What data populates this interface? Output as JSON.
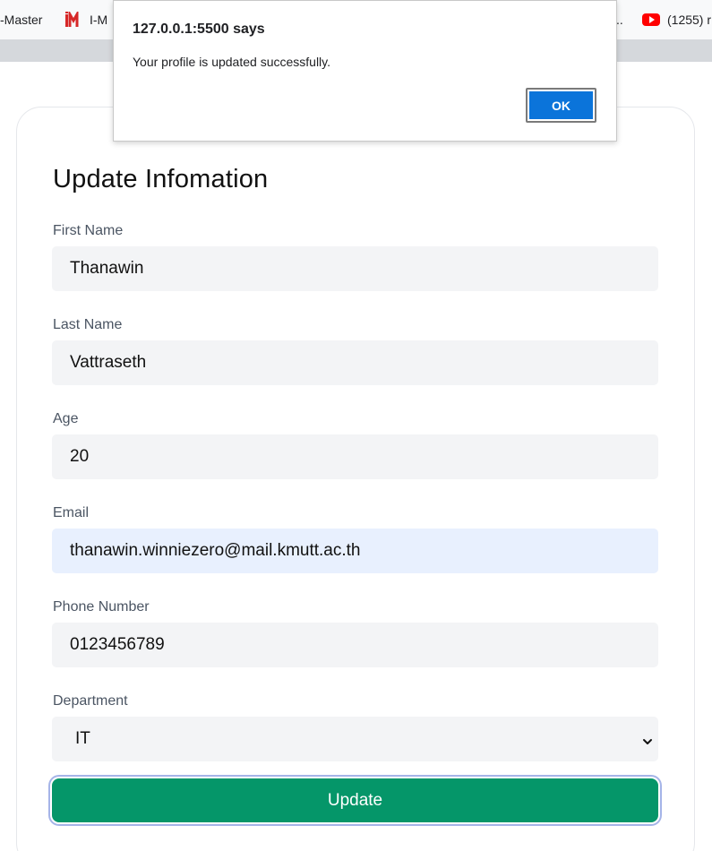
{
  "bookmarks": [
    {
      "label": "-Master",
      "icon": "none"
    },
    {
      "label": "I-M",
      "icon": "imaster-logo-icon"
    },
    {
      "label": "..",
      "icon": "none"
    },
    {
      "label": "(1255) r",
      "icon": "youtube-icon"
    }
  ],
  "alert": {
    "title": "127.0.0.1:5500 says",
    "message": "Your profile is updated successfully.",
    "ok_label": "OK"
  },
  "form": {
    "title": "Update Infomation",
    "fields": [
      {
        "label": "First Name",
        "value": "Thanawin"
      },
      {
        "label": "Last Name",
        "value": "Vattraseth"
      },
      {
        "label": "Age",
        "value": "20"
      },
      {
        "label": "Email",
        "value": "thanawin.winniezero@mail.kmutt.ac.th"
      },
      {
        "label": "Phone Number",
        "value": "0123456789"
      }
    ],
    "department": {
      "label": "Department",
      "value": "IT"
    },
    "submit_label": "Update"
  },
  "colors": {
    "accent": "#059669",
    "alert_button": "#0b74da",
    "input_bg": "#f3f4f6",
    "autofill_bg": "#e8f0fe"
  }
}
